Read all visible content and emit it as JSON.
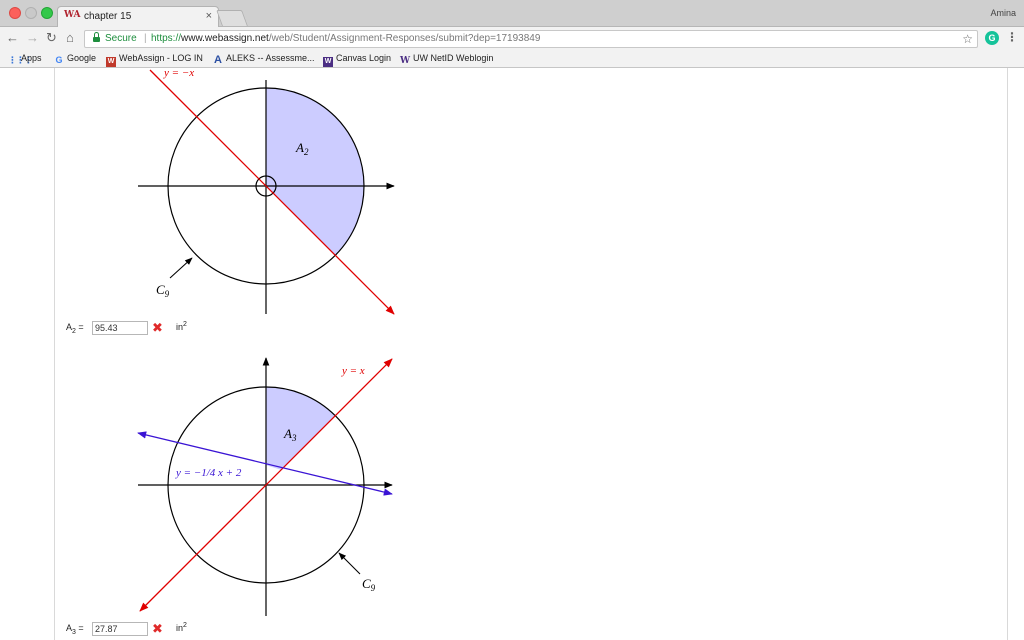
{
  "browser": {
    "tab_favicon": "WA",
    "tab_title": "chapter 15",
    "tab_close": "×",
    "profile": "Amina",
    "secure_label": "Secure",
    "url_scheme": "https://",
    "url_host": "www.webassign.net",
    "url_path": "/web/Student/Assignment-Responses/submit?dep=17193849",
    "extension_letter": "G"
  },
  "bookmarks": [
    {
      "label": "Apps",
      "icon": "apps-grid-icon"
    },
    {
      "label": "Google",
      "icon": "google-icon"
    },
    {
      "label": "WebAssign - LOG IN",
      "icon": "webassign-icon"
    },
    {
      "label": "ALEKS -- Assessme...",
      "icon": "aleks-icon"
    },
    {
      "label": "Canvas Login",
      "icon": "canvas-icon"
    },
    {
      "label": "UW NetID Weblogin",
      "icon": "uw-icon"
    }
  ],
  "figure1": {
    "line_label": "y = −x",
    "region_label": "A",
    "region_sub": "2",
    "circle_label": "C",
    "circle_sub": "9"
  },
  "answer1": {
    "label_main": "A",
    "label_sub": "2",
    "label_eq": " =",
    "value": "95.43",
    "unit": "in",
    "unit_exp": "2"
  },
  "figure2": {
    "line_red_label": "y = x",
    "line_blue_label": "y = −1/4 x + 2",
    "region_label": "A",
    "region_sub": "3",
    "circle_label": "C",
    "circle_sub": "9"
  },
  "answer2": {
    "label_main": "A",
    "label_sub": "3",
    "label_eq": " =",
    "value": "27.87",
    "unit": "in",
    "unit_exp": "2"
  },
  "colors": {
    "region_fill": "#ccccff",
    "red_line": "#e00000",
    "blue_line": "#3a14d4",
    "secure_green": "#1e8e3e"
  }
}
